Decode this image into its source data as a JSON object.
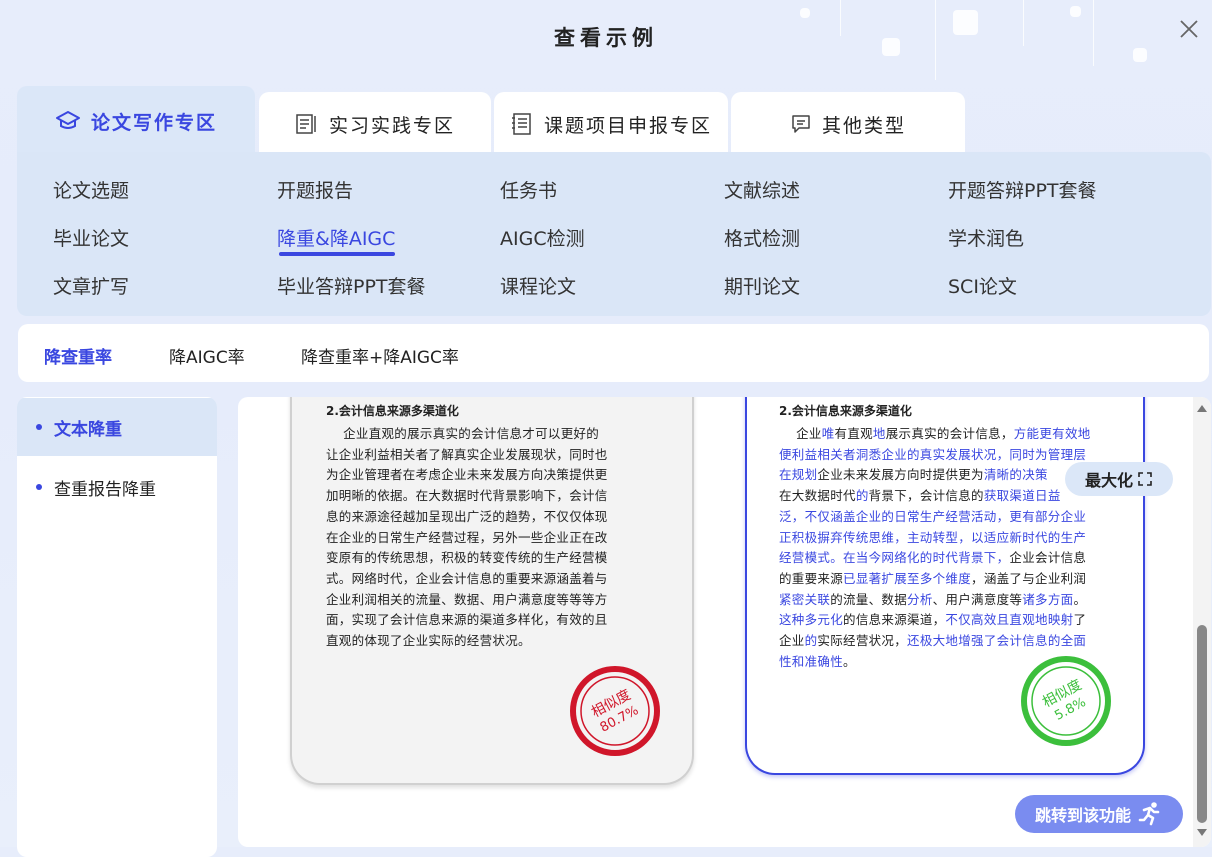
{
  "dialog": {
    "title": "查看示例"
  },
  "top_tabs": [
    {
      "label": "论文写作专区",
      "icon": "graduation-cap-icon"
    },
    {
      "label": "实习实践专区",
      "icon": "document-edit-icon"
    },
    {
      "label": "课题项目申报专区",
      "icon": "notebook-icon"
    },
    {
      "label": "其他类型",
      "icon": "message-icon"
    }
  ],
  "sub_items": [
    [
      "论文选题",
      "开题报告",
      "任务书",
      "文献综述",
      "开题答辩PPT套餐"
    ],
    [
      "毕业论文",
      "降重&降AIGC",
      "AIGC检测",
      "格式检测",
      "学术润色"
    ],
    [
      "文章扩写",
      "毕业答辩PPT套餐",
      "课程论文",
      "期刊论文",
      "SCI论文"
    ]
  ],
  "modes": [
    "降查重率",
    "降AIGC率",
    "降查重率+降AIGC率"
  ],
  "left_nav": [
    "文本降重",
    "查重报告降重"
  ],
  "example": {
    "left_title": "2.会计信息来源多渠道化",
    "left_lines": [
      "    企业直观的展示真实的会计信息才可以更好的",
      "让企业利益相关者了解真实企业发展现状，同时也",
      "为企业管理者在考虑企业未来发展方向决策提供更",
      "加明晰的依据。在大数据时代背景影响下，会计信",
      "息的来源途径越加呈现出广泛的趋势，不仅仅体现",
      "在企业的日常生产经营过程，另外一些企业正在改",
      "变原有的传统思想，积极的转变传统的生产经营模",
      "式。网络时代，企业会计信息的重要来源涵盖着与",
      "企业利润相关的流量、数据、用户满意度等等等方",
      "面，实现了会计信息来源的渠道多样化，有效的且",
      "直观的体现了企业实际的经营状况。"
    ],
    "left_stamp": {
      "label": "相似度",
      "value": "80.7%"
    },
    "right_title": "2.会计信息来源多渠道化",
    "right_lines": [
      [
        [
          "    企业",
          0
        ],
        [
          "唯",
          1
        ],
        [
          "有直观",
          0
        ],
        [
          "地",
          1
        ],
        [
          "展示真实的会计信息，",
          0
        ],
        [
          "方能更有效地",
          1
        ]
      ],
      [
        [
          "便利益相关者洞悉企业的真实发展状况，同时为管理层",
          1
        ]
      ],
      [
        [
          "在规划",
          1
        ],
        [
          "企业未来发展方向时提供更为",
          0
        ],
        [
          "清晰的决策",
          1
        ]
      ],
      [
        [
          "在大数据时代",
          0
        ],
        [
          "的",
          1
        ],
        [
          "背景下，会计信息的",
          0
        ],
        [
          "获取渠道日益",
          1
        ]
      ],
      [
        [
          "泛，不仅涵盖企业的日常生产经营活动，更有部分企业",
          1
        ]
      ],
      [
        [
          "正积极摒弃传统思维，主动转型，以适应新时代的生产",
          1
        ]
      ],
      [
        [
          "经营模式。在当今网络化的时代背景下，",
          1
        ],
        [
          "企业会计信息",
          0
        ]
      ],
      [
        [
          "的重要来源",
          0
        ],
        [
          "已显著扩展至多个维度",
          1
        ],
        [
          "，涵盖了与企业利润",
          0
        ]
      ],
      [
        [
          "紧密关联",
          1
        ],
        [
          "的流量、数据",
          0
        ],
        [
          "分析",
          1
        ],
        [
          "、用户满意度等",
          0
        ],
        [
          "诸多方面",
          1
        ],
        [
          "。",
          0
        ]
      ],
      [
        [
          "这种多元化",
          1
        ],
        [
          "的信息来源渠道，",
          0
        ],
        [
          "不仅高效且直观地映射",
          1
        ],
        [
          "了",
          0
        ]
      ],
      [
        [
          "企业",
          0
        ],
        [
          "的",
          1
        ],
        [
          "实际经营状况，",
          0
        ],
        [
          "还极大地增强了会计信息的全面",
          1
        ]
      ],
      [
        [
          "性和准确性",
          1
        ],
        [
          "。",
          0
        ]
      ]
    ],
    "right_stamp": {
      "label": "相似度",
      "value": "5.8%"
    }
  },
  "buttons": {
    "maximize": "最大化",
    "jump": "跳转到该功能"
  },
  "colors": {
    "accent": "#3a47e0",
    "stamp_red": "#d0162a",
    "stamp_green": "#3cbf3c"
  }
}
